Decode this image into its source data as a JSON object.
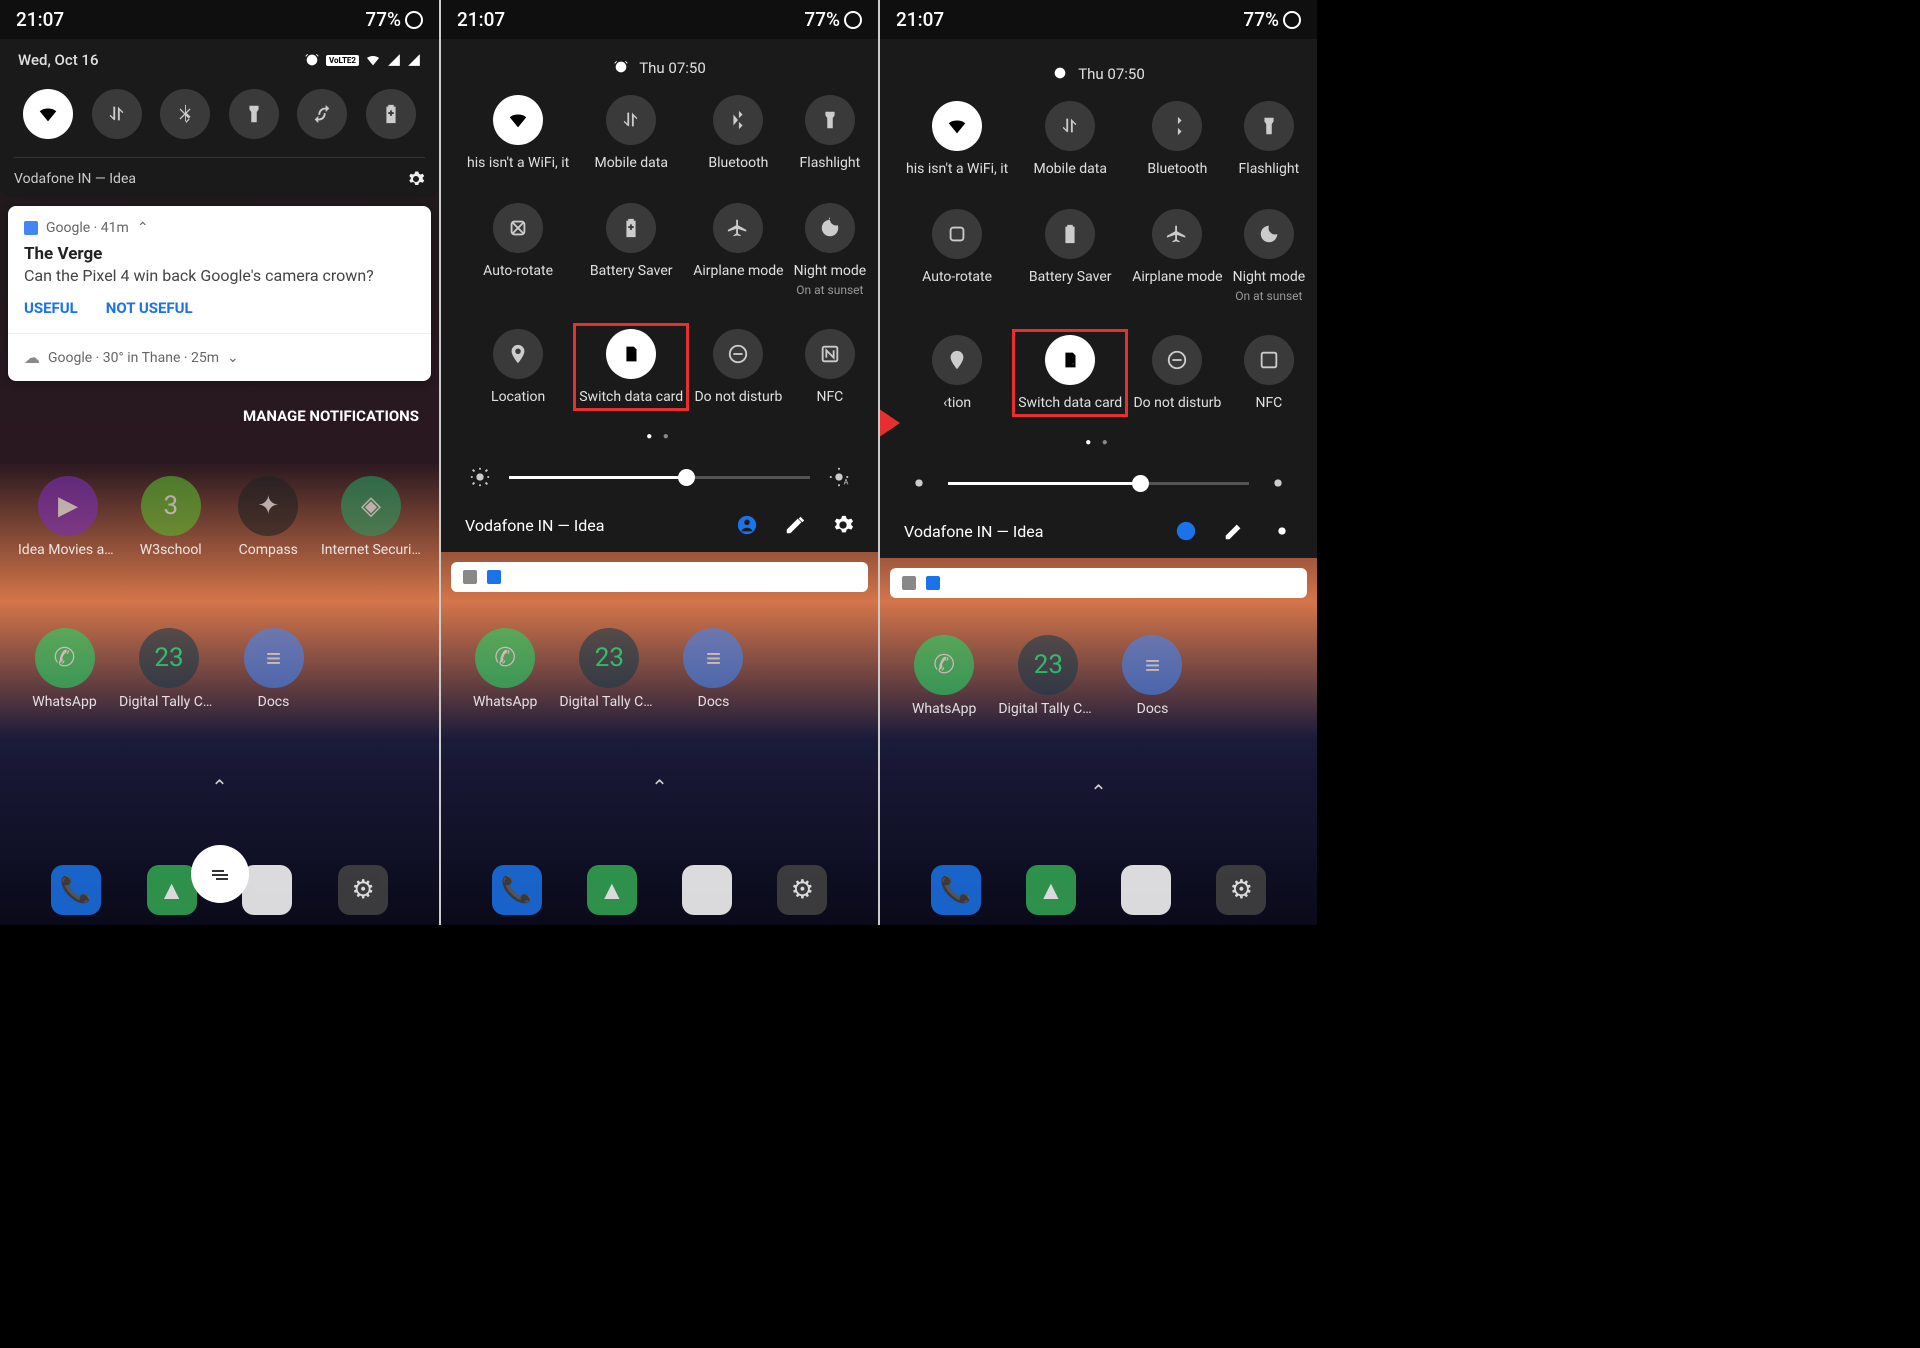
{
  "status": {
    "time": "21:07",
    "battery": "77%"
  },
  "p1": {
    "date": "Wed, Oct 16",
    "volte": "VoLTE2",
    "carrier": "Vodafone IN — Idea",
    "notif_app": "Google · 41m",
    "notif_title": "The Verge",
    "notif_body": "Can the Pixel 4 win back Google's camera crown?",
    "useful": "USEFUL",
    "not_useful": "NOT USEFUL",
    "weather": "Google · 30° in Thane · 25m",
    "manage": "MANAGE NOTIFICATIONS",
    "apps_r1": [
      "Idea Movies an…",
      "W3school",
      "Compass",
      "Internet Security"
    ],
    "apps_r2": [
      "WhatsApp",
      "Digital Tally Co…",
      "Docs",
      ""
    ]
  },
  "alarm": "Thu 07:50",
  "qs_labels": [
    "his isn't a WiFi, it",
    "Mobile data",
    "Bluetooth",
    "Flashlight",
    "Auto-rotate",
    "Battery Saver",
    "Airplane mode",
    "Night mode",
    "Location",
    "Switch data card",
    "Do not disturb",
    "NFC"
  ],
  "night_sub": "On at sunset",
  "carrier2": "Vodafone IN — Idea",
  "p3_qs8": "‹tion",
  "brightness_p2": 58,
  "brightness_p3": 63,
  "apps_r2": [
    "WhatsApp",
    "Digital Tally Co…",
    "Docs"
  ]
}
